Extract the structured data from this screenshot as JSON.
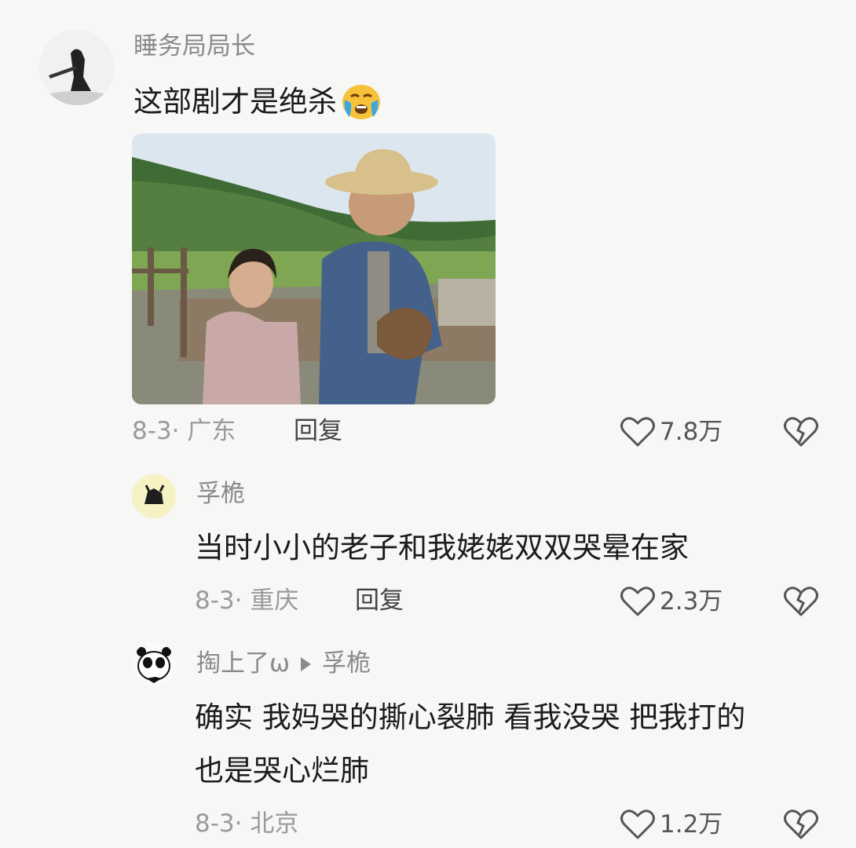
{
  "main_comment": {
    "username": "睡务局局长",
    "text": "这部剧才是绝杀",
    "emoji_icon": "crying-face-icon",
    "image_alt": "still-image-girl-and-old-man",
    "date_location": "8-3· 广东",
    "reply_label": "回复",
    "likes": "7.8万"
  },
  "replies": [
    {
      "username": "孚桅",
      "text": "当时小小的老子和我姥姥双双哭晕在家",
      "date_location": "8-3· 重庆",
      "reply_label": "回复",
      "likes": "2.3万"
    },
    {
      "username": "掏上了ω",
      "reply_to": "孚桅",
      "text_line1": "确实 我妈哭的撕心裂肺 看我没哭 把我打的",
      "text_line2": "也是哭心烂肺",
      "date_location": "8-3· 北京",
      "likes": "1.2万"
    }
  ],
  "colors": {
    "background": "#f7f7f5",
    "username": "#8a8a8a",
    "meta": "#9a9a9a"
  }
}
